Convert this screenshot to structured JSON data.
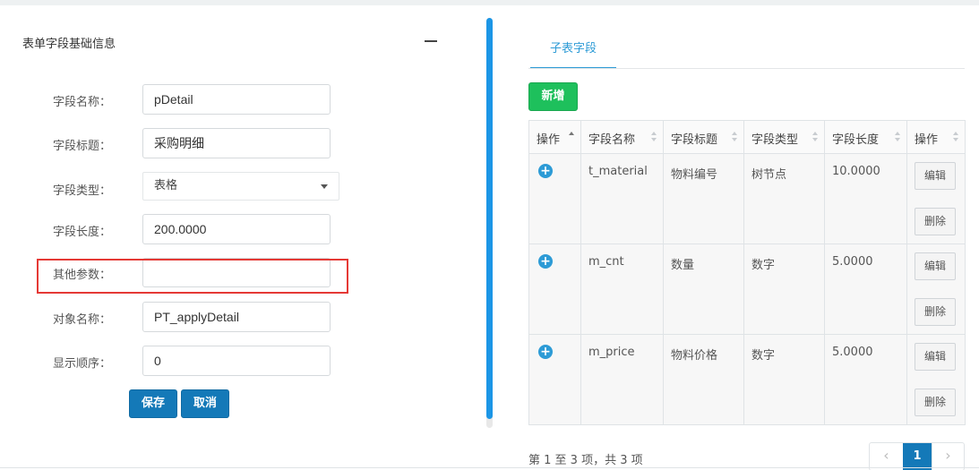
{
  "form": {
    "title": "表单字段基础信息",
    "fields": [
      {
        "label": "字段名称：",
        "value": "pDetail"
      },
      {
        "label": "字段标题：",
        "value": "采购明细"
      },
      {
        "label": "字段类型：",
        "value": "表格"
      },
      {
        "label": "字段长度：",
        "value": "200.0000"
      },
      {
        "label": "其他参数：",
        "value": ""
      },
      {
        "label": "对象名称：",
        "value": "PT_applyDetail"
      },
      {
        "label": "显示顺序：",
        "value": "0"
      }
    ],
    "save_label": "保存",
    "cancel_label": "取消"
  },
  "subtable": {
    "tab_label": "子表字段",
    "add_label": "新增",
    "columns": [
      "操作",
      "字段名称",
      "字段标题",
      "字段类型",
      "字段长度",
      "操作"
    ],
    "rows": [
      {
        "name": "t_material",
        "title": "物料编号",
        "type": "树节点",
        "length": "10.0000"
      },
      {
        "name": "m_cnt",
        "title": "数量",
        "type": "数字",
        "length": "5.0000"
      },
      {
        "name": "m_price",
        "title": "物料价格",
        "type": "数字",
        "length": "5.0000"
      }
    ],
    "edit_label": "编辑",
    "delete_label": "删除",
    "pager_info": "第 1 至 3 项，共 3 项",
    "prev": "‹",
    "current_page": "1",
    "next": "›"
  },
  "colors": {
    "primary": "#1479b8",
    "success": "#1ec05c",
    "tab_accent": "#2d9bd6",
    "highlight": "#e53935"
  }
}
